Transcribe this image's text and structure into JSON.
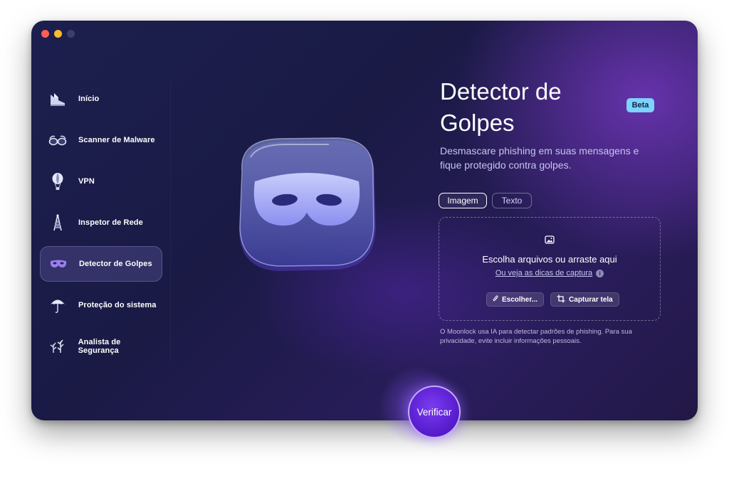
{
  "sidebar": {
    "items": [
      {
        "label": "Início",
        "icon": "home-icon"
      },
      {
        "label": "Scanner de Malware",
        "icon": "glasses-icon"
      },
      {
        "label": "VPN",
        "icon": "balloon-icon"
      },
      {
        "label": "Inspetor de Rede",
        "icon": "tower-icon"
      },
      {
        "label": "Detector de Golpes",
        "icon": "mask-icon",
        "active": true
      },
      {
        "label": "Proteção do sistema",
        "icon": "umbrella-icon"
      },
      {
        "label": "Analista de Segurança",
        "icon": "plants-icon"
      }
    ]
  },
  "main": {
    "title": "Detector de Golpes",
    "badge": "Beta",
    "subtitle": "Desmascare phishing em suas mensagens e fique protegido contra golpes.",
    "tabs": [
      "Imagem",
      "Texto"
    ],
    "active_tab": "Imagem",
    "dropzone": {
      "main_text": "Escolha arquivos ou arraste aqui",
      "link_text": "Ou veja as dicas de captura",
      "choose_button": "Escolher...",
      "capture_button": "Capturar tela"
    },
    "privacy_note": "O Moonlock usa IA para detectar padrões de phishing. Para sua privacidade, evite incluir informações pessoais.",
    "verify_button": "Verificar"
  },
  "colors": {
    "accent": "#5a1fd0",
    "badge": "#7dd3fc",
    "background": "#1c1f4e"
  }
}
